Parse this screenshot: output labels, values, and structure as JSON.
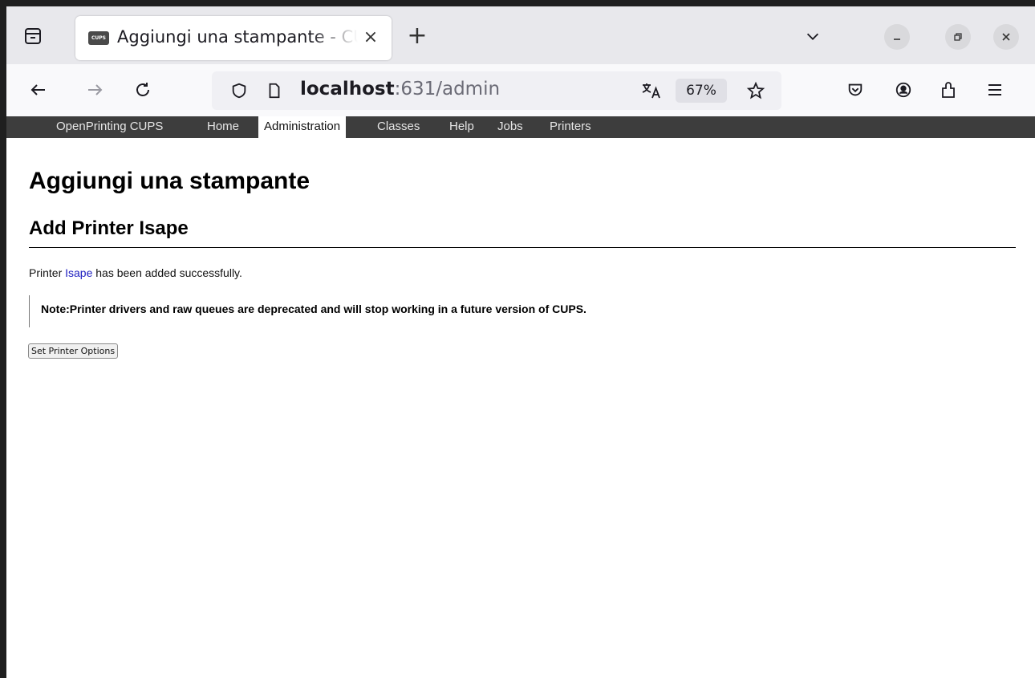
{
  "browser": {
    "tab": {
      "favicon_text": "CUPS",
      "title": "Aggiungi una stampante - CUPS",
      "close_glyph": "×"
    },
    "new_tab_glyph": "+",
    "url": {
      "host": "localhost",
      "rest": ":631/admin"
    },
    "zoom": "67%"
  },
  "cups_nav": {
    "items": [
      "OpenPrinting CUPS",
      "Home",
      "Administration",
      "Classes",
      "Help",
      "Jobs",
      "Printers"
    ],
    "active": "Administration"
  },
  "page": {
    "title": "Aggiungi una stampante",
    "subtitle": "Add Printer Isape",
    "message_prefix": "Printer ",
    "printer_link": "Isape",
    "message_suffix": " has been added successfully.",
    "note": "Note:Printer drivers and raw queues are deprecated and will stop working in a future version of CUPS.",
    "button": "Set Printer Options"
  },
  "icons": [
    "tab-list-icon",
    "close-icon",
    "plus-icon",
    "chevron-down-icon",
    "minimize-icon",
    "restore-icon",
    "back-icon",
    "forward-icon",
    "reload-icon",
    "shield-icon",
    "page-icon",
    "translate-icon",
    "star-icon",
    "pocket-icon",
    "account-icon",
    "extensions-icon",
    "menu-icon"
  ]
}
